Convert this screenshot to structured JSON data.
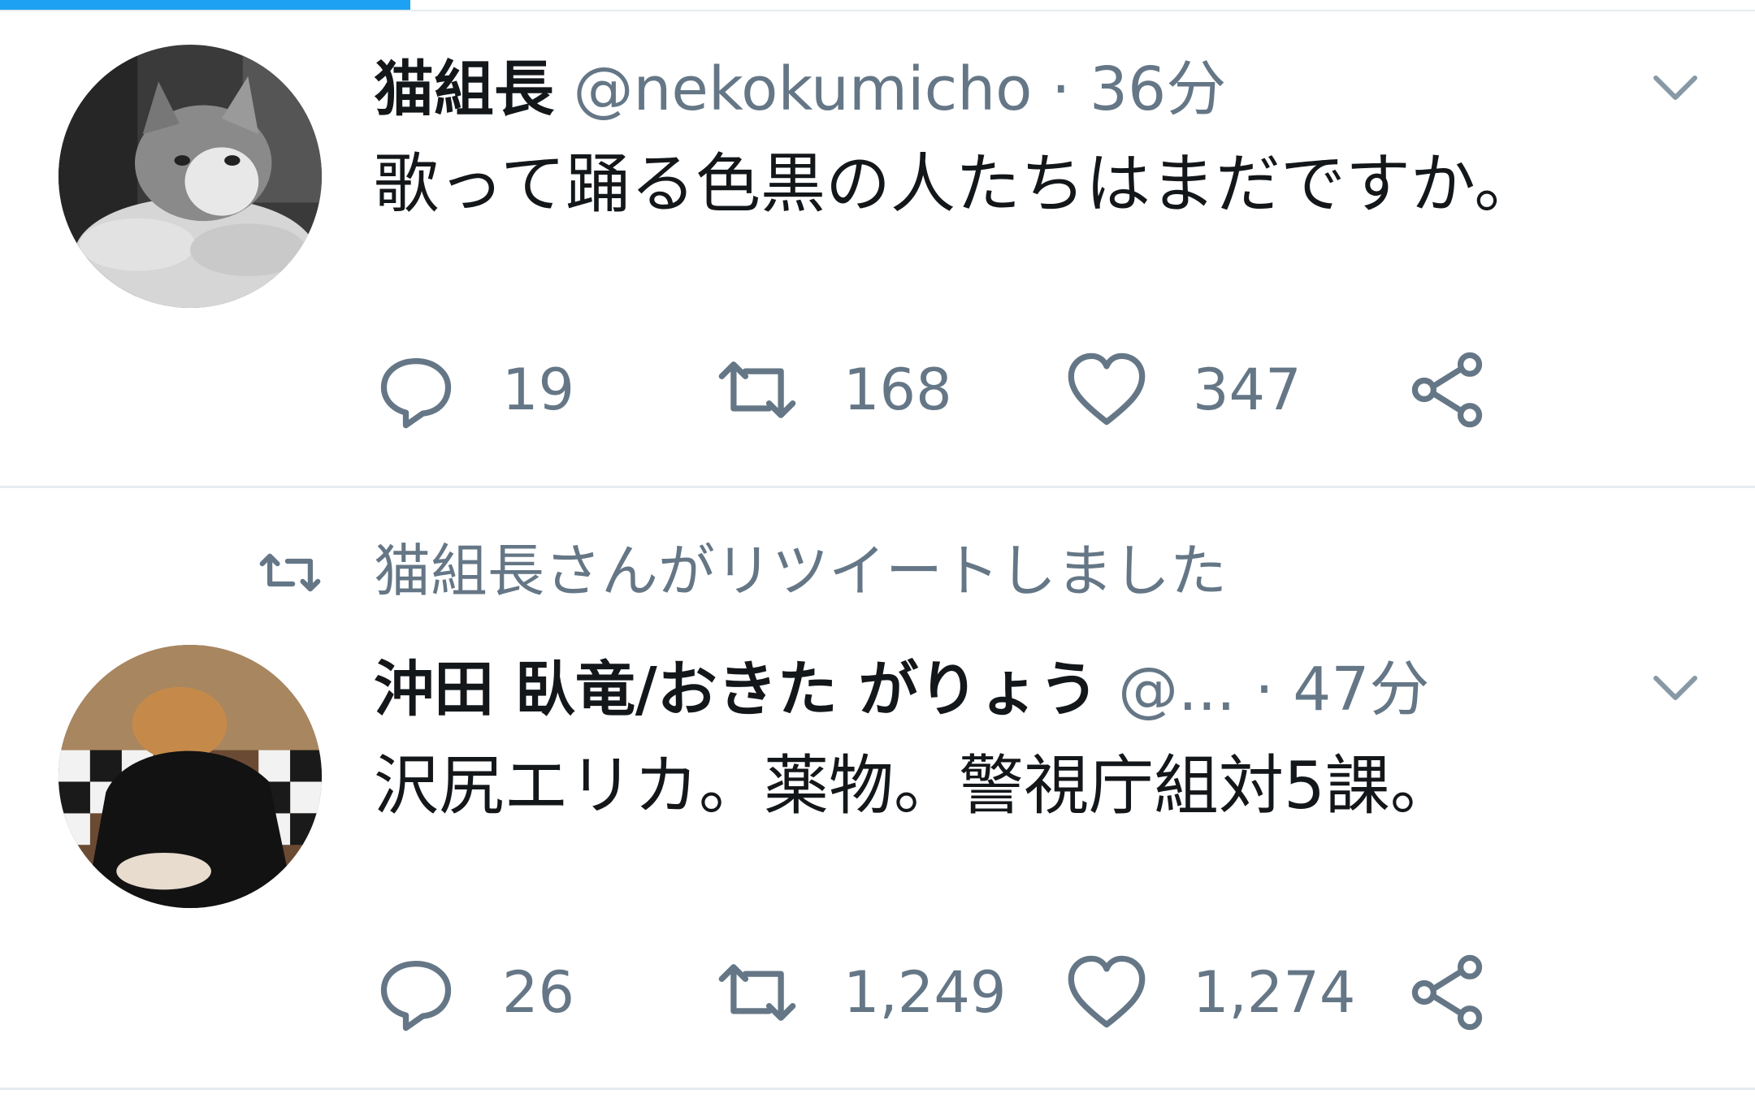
{
  "progress": {
    "fraction": 0.234,
    "color": "#1da1f2"
  },
  "tweets": [
    {
      "avatar_icon": "cat-avatar",
      "name": "猫組長",
      "handle": "@nekokumicho",
      "separator": "·",
      "time": "36分",
      "text": "歌って踊る色黒の人たちはまだですか。",
      "actions": {
        "reply": "19",
        "retweet": "168",
        "like": "347"
      }
    },
    {
      "retweet_context": "猫組長さんがリツイートしました",
      "avatar_icon": "person-avatar",
      "name": "沖田 臥竜/おきた がりょう",
      "handle": "@...",
      "separator": "·",
      "time": "47分",
      "text": "沢尻エリカ。薬物。警視庁組対5課。",
      "actions": {
        "reply": "26",
        "retweet": "1,249",
        "like": "1,274"
      }
    }
  ],
  "colors": {
    "text": "#14171a",
    "secondary": "#657786",
    "divider": "#e6ecf0",
    "accent": "#1da1f2"
  }
}
